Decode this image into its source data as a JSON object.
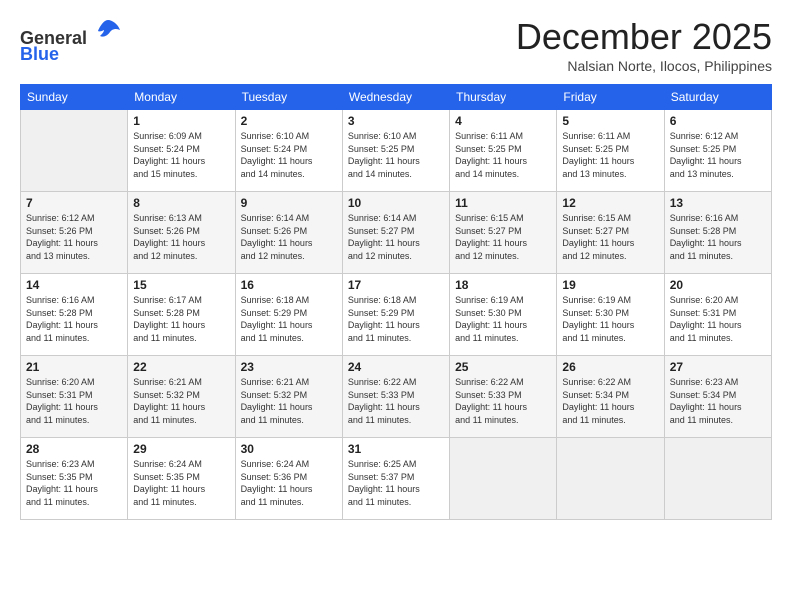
{
  "header": {
    "logo": {
      "line1": "General",
      "line2": "Blue"
    },
    "month": "December 2025",
    "location": "Nalsian Norte, Ilocos, Philippines"
  },
  "columns": [
    "Sunday",
    "Monday",
    "Tuesday",
    "Wednesday",
    "Thursday",
    "Friday",
    "Saturday"
  ],
  "weeks": [
    [
      {
        "day": "",
        "info": ""
      },
      {
        "day": "1",
        "info": "Sunrise: 6:09 AM\nSunset: 5:24 PM\nDaylight: 11 hours\nand 15 minutes."
      },
      {
        "day": "2",
        "info": "Sunrise: 6:10 AM\nSunset: 5:24 PM\nDaylight: 11 hours\nand 14 minutes."
      },
      {
        "day": "3",
        "info": "Sunrise: 6:10 AM\nSunset: 5:25 PM\nDaylight: 11 hours\nand 14 minutes."
      },
      {
        "day": "4",
        "info": "Sunrise: 6:11 AM\nSunset: 5:25 PM\nDaylight: 11 hours\nand 14 minutes."
      },
      {
        "day": "5",
        "info": "Sunrise: 6:11 AM\nSunset: 5:25 PM\nDaylight: 11 hours\nand 13 minutes."
      },
      {
        "day": "6",
        "info": "Sunrise: 6:12 AM\nSunset: 5:25 PM\nDaylight: 11 hours\nand 13 minutes."
      }
    ],
    [
      {
        "day": "7",
        "info": "Sunrise: 6:12 AM\nSunset: 5:26 PM\nDaylight: 11 hours\nand 13 minutes."
      },
      {
        "day": "8",
        "info": "Sunrise: 6:13 AM\nSunset: 5:26 PM\nDaylight: 11 hours\nand 12 minutes."
      },
      {
        "day": "9",
        "info": "Sunrise: 6:14 AM\nSunset: 5:26 PM\nDaylight: 11 hours\nand 12 minutes."
      },
      {
        "day": "10",
        "info": "Sunrise: 6:14 AM\nSunset: 5:27 PM\nDaylight: 11 hours\nand 12 minutes."
      },
      {
        "day": "11",
        "info": "Sunrise: 6:15 AM\nSunset: 5:27 PM\nDaylight: 11 hours\nand 12 minutes."
      },
      {
        "day": "12",
        "info": "Sunrise: 6:15 AM\nSunset: 5:27 PM\nDaylight: 11 hours\nand 12 minutes."
      },
      {
        "day": "13",
        "info": "Sunrise: 6:16 AM\nSunset: 5:28 PM\nDaylight: 11 hours\nand 11 minutes."
      }
    ],
    [
      {
        "day": "14",
        "info": "Sunrise: 6:16 AM\nSunset: 5:28 PM\nDaylight: 11 hours\nand 11 minutes."
      },
      {
        "day": "15",
        "info": "Sunrise: 6:17 AM\nSunset: 5:28 PM\nDaylight: 11 hours\nand 11 minutes."
      },
      {
        "day": "16",
        "info": "Sunrise: 6:18 AM\nSunset: 5:29 PM\nDaylight: 11 hours\nand 11 minutes."
      },
      {
        "day": "17",
        "info": "Sunrise: 6:18 AM\nSunset: 5:29 PM\nDaylight: 11 hours\nand 11 minutes."
      },
      {
        "day": "18",
        "info": "Sunrise: 6:19 AM\nSunset: 5:30 PM\nDaylight: 11 hours\nand 11 minutes."
      },
      {
        "day": "19",
        "info": "Sunrise: 6:19 AM\nSunset: 5:30 PM\nDaylight: 11 hours\nand 11 minutes."
      },
      {
        "day": "20",
        "info": "Sunrise: 6:20 AM\nSunset: 5:31 PM\nDaylight: 11 hours\nand 11 minutes."
      }
    ],
    [
      {
        "day": "21",
        "info": "Sunrise: 6:20 AM\nSunset: 5:31 PM\nDaylight: 11 hours\nand 11 minutes."
      },
      {
        "day": "22",
        "info": "Sunrise: 6:21 AM\nSunset: 5:32 PM\nDaylight: 11 hours\nand 11 minutes."
      },
      {
        "day": "23",
        "info": "Sunrise: 6:21 AM\nSunset: 5:32 PM\nDaylight: 11 hours\nand 11 minutes."
      },
      {
        "day": "24",
        "info": "Sunrise: 6:22 AM\nSunset: 5:33 PM\nDaylight: 11 hours\nand 11 minutes."
      },
      {
        "day": "25",
        "info": "Sunrise: 6:22 AM\nSunset: 5:33 PM\nDaylight: 11 hours\nand 11 minutes."
      },
      {
        "day": "26",
        "info": "Sunrise: 6:22 AM\nSunset: 5:34 PM\nDaylight: 11 hours\nand 11 minutes."
      },
      {
        "day": "27",
        "info": "Sunrise: 6:23 AM\nSunset: 5:34 PM\nDaylight: 11 hours\nand 11 minutes."
      }
    ],
    [
      {
        "day": "28",
        "info": "Sunrise: 6:23 AM\nSunset: 5:35 PM\nDaylight: 11 hours\nand 11 minutes."
      },
      {
        "day": "29",
        "info": "Sunrise: 6:24 AM\nSunset: 5:35 PM\nDaylight: 11 hours\nand 11 minutes."
      },
      {
        "day": "30",
        "info": "Sunrise: 6:24 AM\nSunset: 5:36 PM\nDaylight: 11 hours\nand 11 minutes."
      },
      {
        "day": "31",
        "info": "Sunrise: 6:25 AM\nSunset: 5:37 PM\nDaylight: 11 hours\nand 11 minutes."
      },
      {
        "day": "",
        "info": ""
      },
      {
        "day": "",
        "info": ""
      },
      {
        "day": "",
        "info": ""
      }
    ]
  ]
}
